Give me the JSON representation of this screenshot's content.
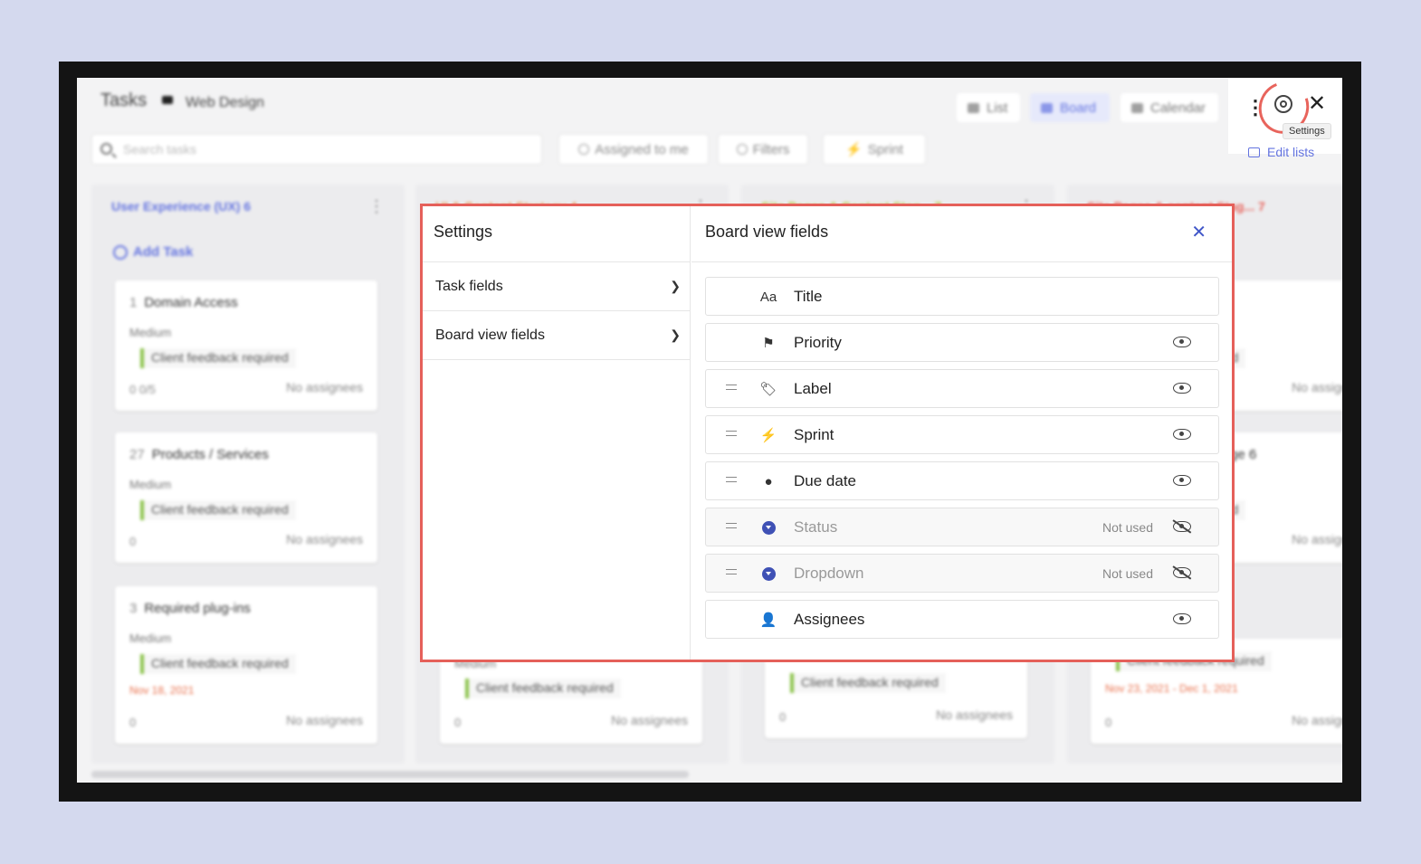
{
  "header": {
    "title": "Tasks",
    "project": "Web Design"
  },
  "views": [
    "List",
    "Board",
    "Calendar"
  ],
  "search": {
    "placeholder": "Search tasks"
  },
  "filters": {
    "assigned": "Assigned to me",
    "filters": "Filters",
    "sprint": "Sprint"
  },
  "toolbar": {
    "tooltip": "Settings",
    "edit_lists": "Edit lists"
  },
  "columns": [
    {
      "title": "User Experience (UX)",
      "count": "6",
      "color": "#6474e0",
      "add_task": "Add Task"
    },
    {
      "title": "UI & Content Strategy",
      "count": "4",
      "color": "#e8904c"
    },
    {
      "title": "Site Pages & Content Stag...",
      "count": "7",
      "color": "#cddc39"
    },
    {
      "title": "Site Pages & content Stag...",
      "count": "7",
      "color": "#e8645c"
    }
  ],
  "cards": [
    {
      "num": "1",
      "title": "Domain Access",
      "priority": "Medium",
      "tag": "Client feedback required",
      "foot": "0   0/5",
      "assignees": "No assignees"
    },
    {
      "num": "27",
      "title": "Products / Services",
      "priority": "Medium",
      "tag": "Client feedback required",
      "foot": "0",
      "assignees": "No assignees"
    },
    {
      "num": "3",
      "title": "Required plug-ins",
      "priority": "Medium",
      "tag": "Client feedback required",
      "date": "Nov 18, 2021",
      "foot": "0",
      "assignees": "No assignees"
    },
    {
      "priority": "Medium",
      "tag": "Client feedback required",
      "foot": "0",
      "assignees": "No assignees"
    },
    {
      "tag": "Client feedback required",
      "foot": "0",
      "assignees": "No assignees"
    },
    {
      "tag": "required",
      "assignees": "No assignee"
    },
    {
      "title": "ge 6",
      "tag": "required",
      "assignees": "No assignee"
    },
    {
      "tag": "Client feedback required",
      "date": "Nov 23, 2021 - Dec 1, 2021",
      "foot": "0",
      "assignees": "No assignee"
    }
  ],
  "modal": {
    "left_title": "Settings",
    "nav": [
      "Task fields",
      "Board view fields"
    ],
    "right_title": "Board view fields",
    "fields": [
      {
        "label": "Title",
        "icon": "text-icon",
        "glyph": "Aa",
        "draggable": false,
        "visible": null,
        "note": ""
      },
      {
        "label": "Priority",
        "icon": "flag-icon",
        "glyph": "⚑",
        "draggable": false,
        "visible": true,
        "note": ""
      },
      {
        "label": "Label",
        "icon": "tag-icon",
        "glyph": "🏷",
        "draggable": true,
        "visible": true,
        "note": ""
      },
      {
        "label": "Sprint",
        "icon": "lightning-icon",
        "glyph": "⚡",
        "draggable": true,
        "visible": true,
        "note": ""
      },
      {
        "label": "Due date",
        "icon": "clock-icon",
        "glyph": "●",
        "draggable": true,
        "visible": true,
        "note": ""
      },
      {
        "label": "Status",
        "icon": "status-dropdown-icon",
        "glyph": "",
        "draggable": true,
        "visible": false,
        "note": "Not used"
      },
      {
        "label": "Dropdown",
        "icon": "dropdown-icon",
        "glyph": "",
        "draggable": true,
        "visible": false,
        "note": "Not used"
      },
      {
        "label": "Assignees",
        "icon": "person-icon",
        "glyph": "👤",
        "draggable": false,
        "visible": true,
        "note": ""
      }
    ]
  }
}
